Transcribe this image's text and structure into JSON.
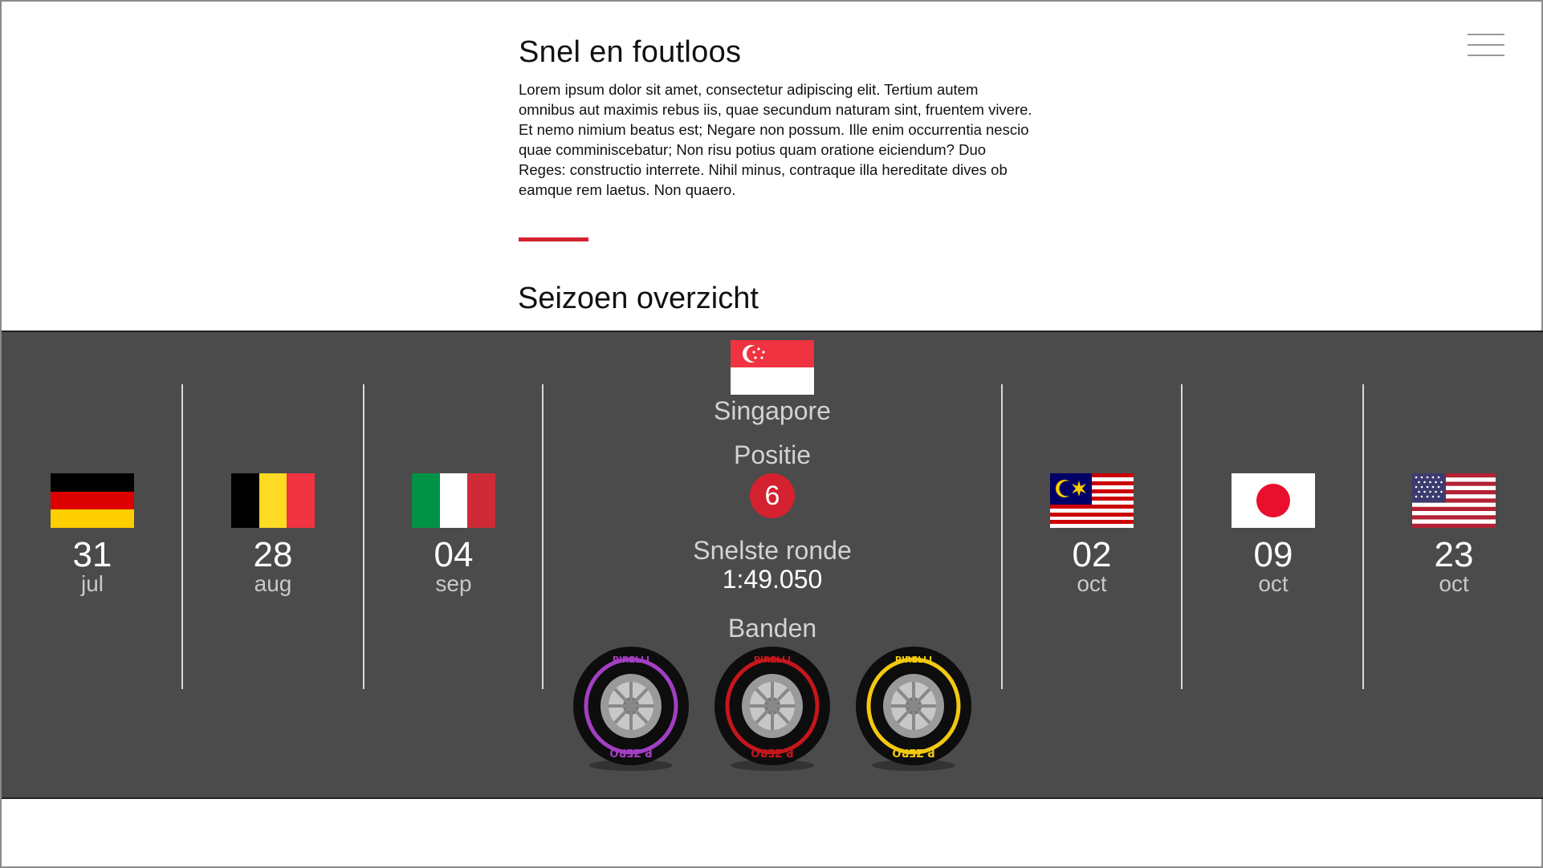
{
  "header": {
    "title": "Snel en foutloos",
    "body": "Lorem ipsum dolor sit amet, consectetur adipiscing elit. Tertium autem omnibus aut maximis rebus iis, quae secundum naturam sint, fruentem vivere. Et nemo nimium beatus est; Negare non possum. Ille enim occurrentia nescio quae comminiscebatur; Non risu potius quam oratione eiciendum? Duo Reges: constructio interrete. Nihil minus, contraque illa hereditate dives ob eamque rem laetus. Non quaero."
  },
  "section": {
    "title": "Seizoen overzicht"
  },
  "menu": {
    "icon": "hamburger-icon"
  },
  "races_before": [
    {
      "country": "Germany",
      "flag": "germany-flag-icon",
      "day": "31",
      "month": "jul"
    },
    {
      "country": "Belgium",
      "flag": "belgium-flag-icon",
      "day": "28",
      "month": "aug"
    },
    {
      "country": "Italy",
      "flag": "italy-flag-icon",
      "day": "04",
      "month": "sep"
    }
  ],
  "featured": {
    "flag": "singapore-flag-icon",
    "country": "Singapore",
    "position_label": "Positie",
    "position": "6",
    "fastest_lap_label": "Snelste ronde",
    "fastest_lap": "1:49.050",
    "tyres_label": "Banden",
    "tyres": [
      {
        "name": "purple-tyre-icon",
        "color": "#a23fc2",
        "brand": "PIRELLI",
        "model": "P ZERO"
      },
      {
        "name": "red-tyre-icon",
        "color": "#c4161c",
        "brand": "PIRELLI",
        "model": "P ZERO"
      },
      {
        "name": "yellow-tyre-icon",
        "color": "#f2c811",
        "brand": "PIRELLI",
        "model": "P ZERO"
      }
    ]
  },
  "races_after": [
    {
      "country": "Malaysia",
      "flag": "malaysia-flag-icon",
      "day": "02",
      "month": "oct"
    },
    {
      "country": "Japan",
      "flag": "japan-flag-icon",
      "day": "09",
      "month": "oct"
    },
    {
      "country": "United States",
      "flag": "usa-flag-icon",
      "day": "23",
      "month": "oct"
    }
  ],
  "colors": {
    "accent": "#d4212f",
    "timeline_bg": "#4b4b4b"
  }
}
